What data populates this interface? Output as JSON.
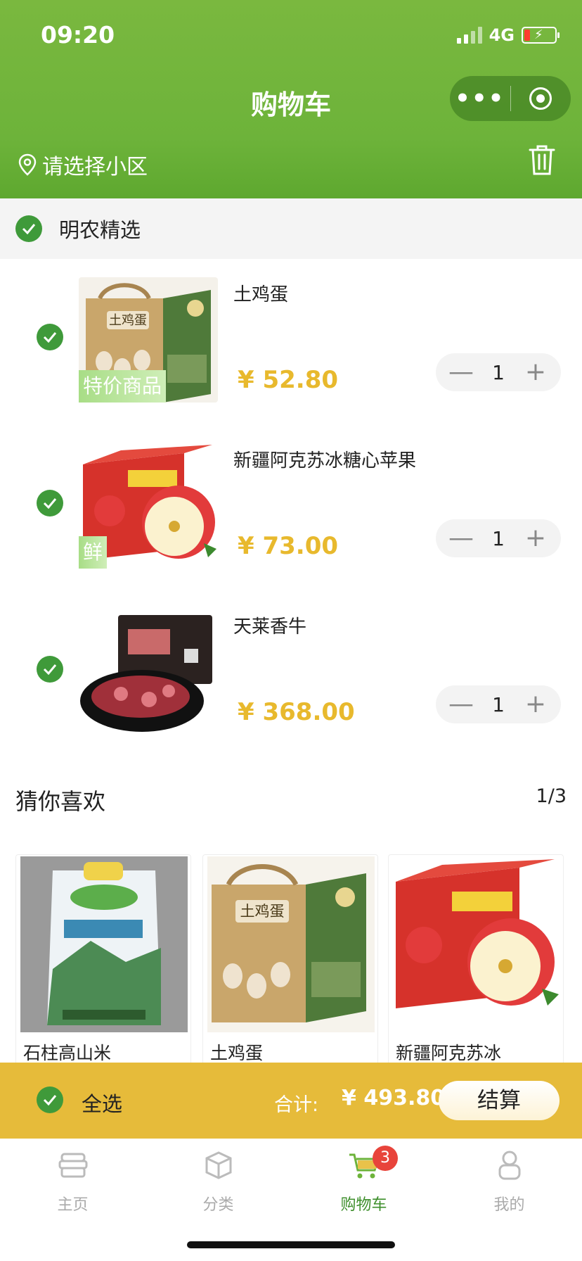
{
  "status": {
    "time": "09:20",
    "network": "4G"
  },
  "header": {
    "title": "购物车",
    "location": "请选择小区"
  },
  "shop": {
    "name": "明农精选"
  },
  "cart_items": [
    {
      "name": "土鸡蛋",
      "price": "¥ 52.80",
      "qty": "1",
      "tag": "特价商品",
      "image": "egg-gift-box"
    },
    {
      "name": "新疆阿克苏冰糖心苹果",
      "price": "¥ 73.00",
      "qty": "1",
      "tag": "鲜",
      "image": "apple-box"
    },
    {
      "name": "天莱香牛",
      "price": "¥ 368.00",
      "qty": "1",
      "tag": "",
      "image": "beef-pack"
    }
  ],
  "recommend": {
    "title": "猜你喜欢",
    "page": "1/3",
    "items": [
      {
        "name": "石柱高山米",
        "image": "rice-bag"
      },
      {
        "name": "土鸡蛋",
        "image": "egg-gift-box"
      },
      {
        "name": "新疆阿克苏冰",
        "image": "apple-box"
      }
    ]
  },
  "checkout": {
    "select_all": "全选",
    "total_label": "合计:",
    "total": "¥ 493.80",
    "button": "结算"
  },
  "tabbar": {
    "items": [
      {
        "label": "主页",
        "icon": "home-icon"
      },
      {
        "label": "分类",
        "icon": "category-icon"
      },
      {
        "label": "购物车",
        "icon": "cart-icon",
        "badge": "3"
      },
      {
        "label": "我的",
        "icon": "profile-icon"
      }
    ]
  },
  "colors": {
    "header_green": "#6db33a",
    "check_green": "#3f9a3a",
    "price_gold": "#e8b92d",
    "checkout_bar": "#e6bb3a",
    "active_tab": "#3e8f2c"
  }
}
